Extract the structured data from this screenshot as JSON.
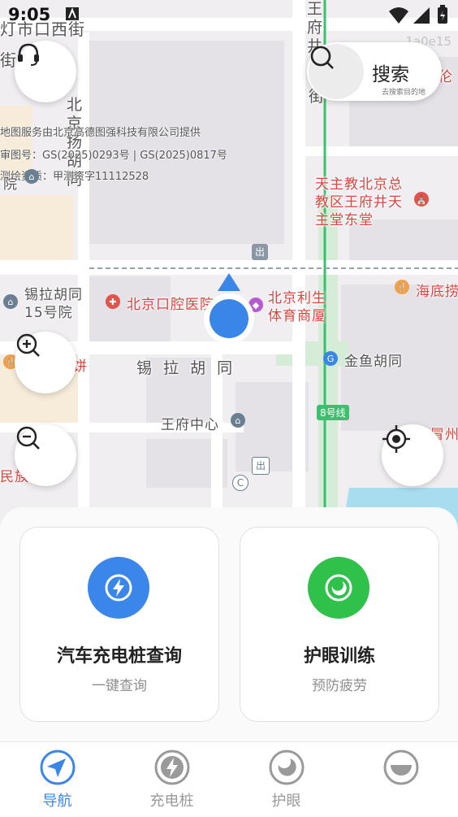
{
  "status_bar": {
    "time": "9:05"
  },
  "map": {
    "id_text": "1a0e15",
    "copyright_lines": [
      "地图服务由北京高德图强科技有限公司提供",
      "审图号：GS(2025)0293号 | GS(2025)0817号",
      "测绘资质：甲测资字11112528"
    ],
    "streets": {
      "top_left": "灯市口西街",
      "top_left_2": "街",
      "vertical_left": "北京扬胡同",
      "vertical_right": "王府井",
      "vertical_right_2": "街",
      "xila": "锡 拉 胡 同",
      "subway_line": "8号线"
    },
    "pois": {
      "xila15": "锡拉胡同\n15号院",
      "dental": "北京口腔医院",
      "lisheng": "北京利生\n体育商厦",
      "church": "天主教北京总\n教区王府井天\n主堂东堂",
      "haidilao": "海底捞",
      "jinyu": "金鱼胡同",
      "wangfu": "王府中心",
      "minzu": "民族饭店",
      "binggu": "饼",
      "meizhou": "冒州",
      "yuan": "院",
      "lun": "伦"
    },
    "exit_label": "出",
    "c_label": "C",
    "colors": {
      "water": "#a8dcef",
      "green": "#d5ecd6",
      "road": "#ffffff",
      "block": "#e6e3e8"
    }
  },
  "controls": {
    "support_icon": "headset-icon",
    "zoom_in_icon": "zoom-in-icon",
    "zoom_out_icon": "zoom-out-icon",
    "locate_icon": "crosshair-icon"
  },
  "search": {
    "label": "搜索",
    "hint": "去搜索目的地",
    "icon": "search-icon"
  },
  "cards": [
    {
      "title": "汽车充电桩查询",
      "subtitle": "一键查询",
      "icon": "charging-icon",
      "color": "#3b86ea"
    },
    {
      "title": "护眼训练",
      "subtitle": "预防疲劳",
      "icon": "eye-care-icon",
      "color": "#2fc14a"
    }
  ],
  "tabs": [
    {
      "label": "导航",
      "icon": "navigation-icon",
      "active": true
    },
    {
      "label": "充电桩",
      "icon": "charging-icon",
      "active": false
    },
    {
      "label": "护眼",
      "icon": "moon-icon",
      "active": false
    },
    {
      "label": "",
      "icon": "bowl-icon",
      "active": false
    }
  ],
  "accent": "#3a86e8"
}
